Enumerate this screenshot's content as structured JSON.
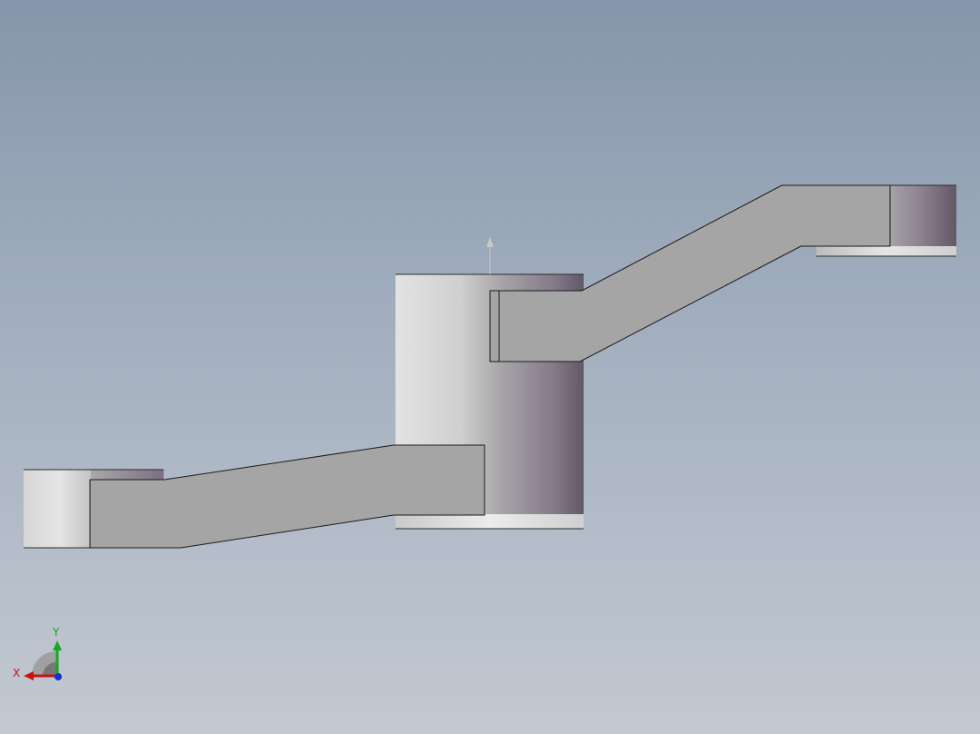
{
  "window": {
    "type": "cad-3d-viewport"
  },
  "colors": {
    "background_top": "#8596ab",
    "background_bottom": "#c3c9d2",
    "arm_face": "#a5a5a5",
    "edge": "#1a1a1a",
    "cylinder_light": "#e0e0e0",
    "cylinder_dark": "#6d6070",
    "axis_x": "#cc1111",
    "axis_y": "#11aa22",
    "axis_z": "#1133cc"
  },
  "model": {
    "parts": [
      "central-hub",
      "lower-left-arm",
      "upper-right-arm",
      "left-boss",
      "right-boss"
    ]
  },
  "triad": {
    "x_label": "X",
    "y_label": "Y"
  }
}
